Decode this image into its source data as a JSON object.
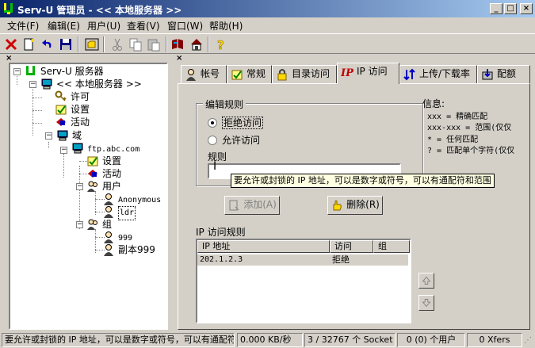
{
  "window": {
    "title": "Serv-U 管理员 - << 本地服务器 >>",
    "min_label": "_",
    "max_label": "□",
    "close_label": "×",
    "icon": "serv-u-icon"
  },
  "menubar": [
    {
      "label": "文件(F)"
    },
    {
      "label": "编辑(E)"
    },
    {
      "label": "用户(U)"
    },
    {
      "label": "查看(V)"
    },
    {
      "label": "窗口(W)"
    },
    {
      "label": "帮助(H)"
    }
  ],
  "toolbar": {
    "icons": [
      "delete-icon",
      "new-icon",
      "undo-icon",
      "save-icon",
      "open-folder-icon",
      "cut-icon",
      "copy-icon",
      "paste-icon",
      "book-icon",
      "home-icon",
      "help-icon"
    ]
  },
  "tree": {
    "root": "Serv-U 服务器",
    "local_server": "<< 本地服务器 >>",
    "license": "许可",
    "settings": "设置",
    "activity": "活动",
    "domains": "域",
    "domain_name": "ftp.abc.com",
    "domain_settings": "设置",
    "domain_activity": "活动",
    "users": "用户",
    "user1": "Anonymous",
    "user2": "ldr",
    "groups": "组",
    "group1": "999",
    "group2": "副本999"
  },
  "tabs": [
    {
      "label": "帐号",
      "icon": "user-icon"
    },
    {
      "label": "常规",
      "icon": "checklist-icon"
    },
    {
      "label": "目录访问",
      "icon": "lock-icon"
    },
    {
      "label": "IP 访问",
      "icon": "ip-icon"
    },
    {
      "label": "上传/下载率",
      "icon": "transfer-icon"
    },
    {
      "label": "配额",
      "icon": "quota-icon"
    }
  ],
  "ip_access": {
    "edit_rules_title": "编辑规则",
    "deny_label": "拒绝访问",
    "allow_label": "允许访问",
    "selected": "deny",
    "rule_label": "规则",
    "rule_value": "",
    "add_button": "添加(A)",
    "delete_button": "删除(R)",
    "tooltip": "要允许或封锁的 IP 地址，可以是数字或符号，可以有通配符和范围",
    "info_title": "信息:",
    "info_lines": [
      "xxx = 精确匹配",
      "xxx-xxx = 范围(仅仅",
      "* = 任何匹配",
      "? = 匹配单个字符(仅仅"
    ],
    "rules_title": "IP 访问规则",
    "columns": [
      "IP 地址",
      "访问",
      "组"
    ],
    "rows": [
      {
        "ip": "202.1.2.3",
        "access": "拒绝",
        "group": ""
      }
    ]
  },
  "statusbar": {
    "message": "要允许或封锁的 IP 地址，可以是数字或符号，可以有通配符和范围",
    "speed": "0.000 KB/秒",
    "sockets": "3 / 32767 个 Socket",
    "users": "0 (0) 个用户",
    "xfers": "0 Xfers"
  }
}
